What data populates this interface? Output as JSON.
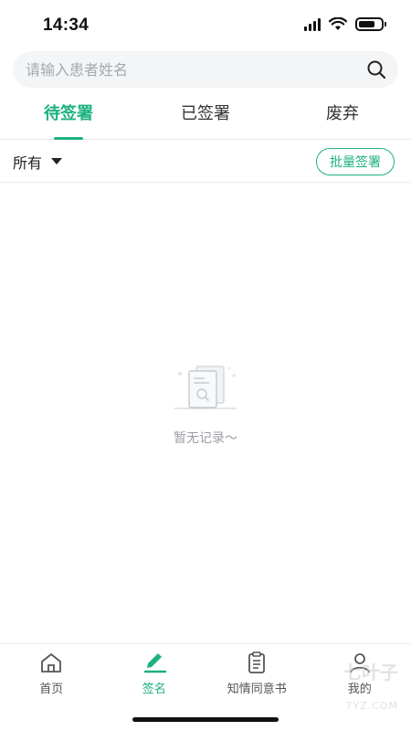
{
  "status_bar": {
    "time": "14:34"
  },
  "search": {
    "placeholder": "请输入患者姓名"
  },
  "tabs": [
    {
      "label": "待签署",
      "active": true
    },
    {
      "label": "已签署",
      "active": false
    },
    {
      "label": "废弃",
      "active": false
    }
  ],
  "filter": {
    "selected": "所有",
    "batch_label": "批量签署"
  },
  "empty": {
    "text": "暂无记录～",
    "icon": "empty-document-search-icon"
  },
  "bottom_nav": [
    {
      "label": "首页",
      "icon": "home-icon",
      "active": false
    },
    {
      "label": "签名",
      "icon": "pen-icon",
      "active": true
    },
    {
      "label": "知情同意书",
      "icon": "clipboard-icon",
      "active": false
    },
    {
      "label": "我的",
      "icon": "person-icon",
      "active": false
    }
  ],
  "watermark": {
    "text": "七叶子",
    "sub": "7YZ.COM"
  },
  "colors": {
    "accent": "#1cb27d",
    "text": "#222222",
    "muted": "#9a9ea5",
    "search_bg": "#f4f5f6"
  }
}
